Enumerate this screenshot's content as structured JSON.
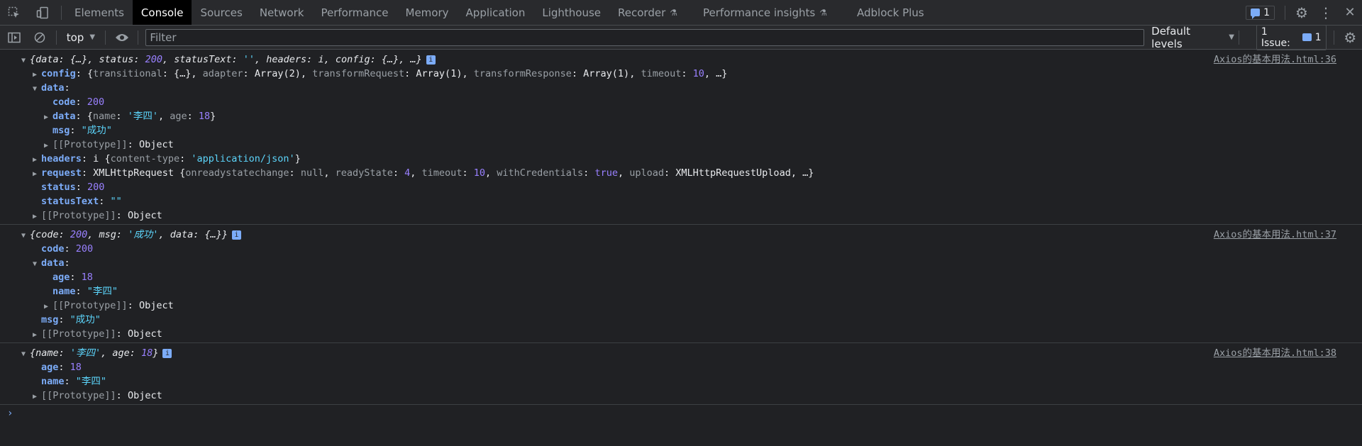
{
  "tabbar": {
    "tabs": [
      "Elements",
      "Console",
      "Sources",
      "Network",
      "Performance",
      "Memory",
      "Application",
      "Lighthouse",
      "Recorder",
      "Performance insights",
      "Adblock Plus"
    ],
    "active_tab": "Console",
    "messages_count": "1"
  },
  "toolbar": {
    "context": "top",
    "filter_placeholder": "Filter",
    "levels": "Default levels",
    "issues_label": "1 Issue:",
    "issues_count": "1"
  },
  "console": {
    "entries": [
      {
        "source": "Axios的基本用法.html:36",
        "summary": {
          "data": "{…}",
          "status": "200",
          "statusText": "''",
          "headers": "i",
          "config": "{…}"
        },
        "config": {
          "transitional": "{…}",
          "adapter": "Array(2)",
          "transformRequest": "Array(1)",
          "transformResponse": "Array(1)",
          "timeout": "10"
        },
        "data": {
          "code": "200",
          "data_name": "'李四'",
          "data_age": "18",
          "msg": "\"成功\"",
          "prototype": "Object"
        },
        "headers": {
          "type": "i",
          "content_type": "'application/json'"
        },
        "request": {
          "type": "XMLHttpRequest",
          "onreadystatechange": "null",
          "readyState": "4",
          "timeout": "10",
          "withCredentials": "true",
          "upload": "XMLHttpRequestUpload"
        },
        "status": "200",
        "statusText": "\"\"",
        "prototype": "Object"
      },
      {
        "source": "Axios的基本用法.html:37",
        "summary": {
          "code": "200",
          "msg": "'成功'",
          "data": "{…}"
        },
        "code": "200",
        "data": {
          "age": "18",
          "name": "\"李四\"",
          "prototype": "Object"
        },
        "msg": "\"成功\"",
        "prototype": "Object"
      },
      {
        "source": "Axios的基本用法.html:38",
        "summary": {
          "name": "'李四'",
          "age": "18"
        },
        "age": "18",
        "name": "\"李四\"",
        "prototype": "Object"
      }
    ]
  }
}
